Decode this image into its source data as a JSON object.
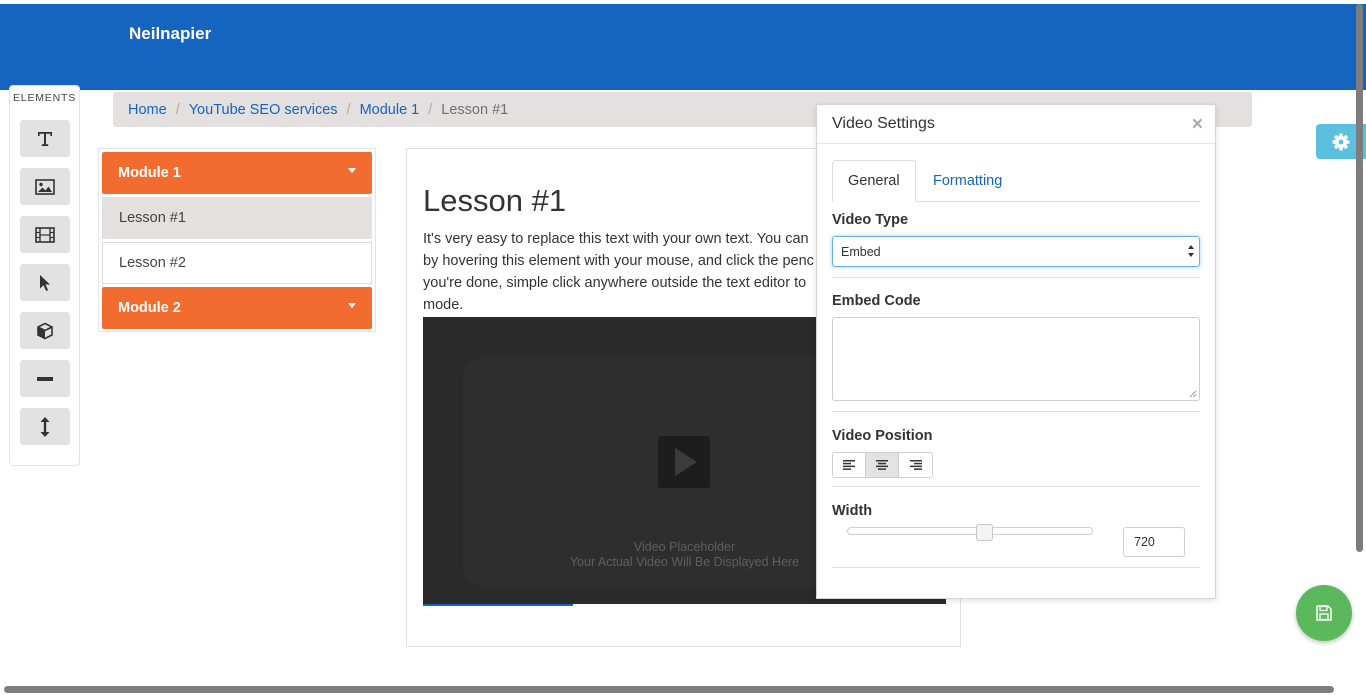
{
  "brand": {
    "name": "Neilnapier"
  },
  "breadcrumb": {
    "items": [
      "Home",
      "YouTube SEO services",
      "Module 1"
    ],
    "active": "Lesson #1",
    "separator": "/"
  },
  "elements_panel": {
    "title": "ELEMENTS",
    "tools": [
      "text-icon",
      "image-icon",
      "film-icon",
      "cursor-icon",
      "cube-icon",
      "minus-icon",
      "vertical-resize-icon"
    ]
  },
  "menu": {
    "module1": "Module 1",
    "lessons": [
      "Lesson #1",
      "Lesson #2"
    ],
    "module2": "Module 2"
  },
  "content": {
    "title": "Lesson #1",
    "text_lines": [
      "It's very easy to replace this text with your own text. You can",
      "by hovering this element with your mouse, and click the penc",
      "you're done, simple click anywhere outside the text editor to",
      "mode."
    ],
    "video": {
      "line1": "Video Placeholder",
      "line2": "Your Actual Video Will Be Displayed Here"
    }
  },
  "modal": {
    "title": "Video Settings",
    "close": "×",
    "tabs": {
      "general": "General",
      "formatting": "Formatting"
    },
    "video_type_label": "Video Type",
    "video_type_value": "Embed",
    "embed_code_label": "Embed Code",
    "video_position_label": "Video Position",
    "width_label": "Width",
    "width_value": "720",
    "width_slider_fraction": 0.56
  },
  "colors": {
    "header": "#1565c0",
    "module": "#f36c2f",
    "settings_tab": "#5bc0de",
    "save_button": "#5cb85c"
  },
  "icons": {
    "settings": "gear-icon",
    "save": "floppy-disk-icon"
  }
}
